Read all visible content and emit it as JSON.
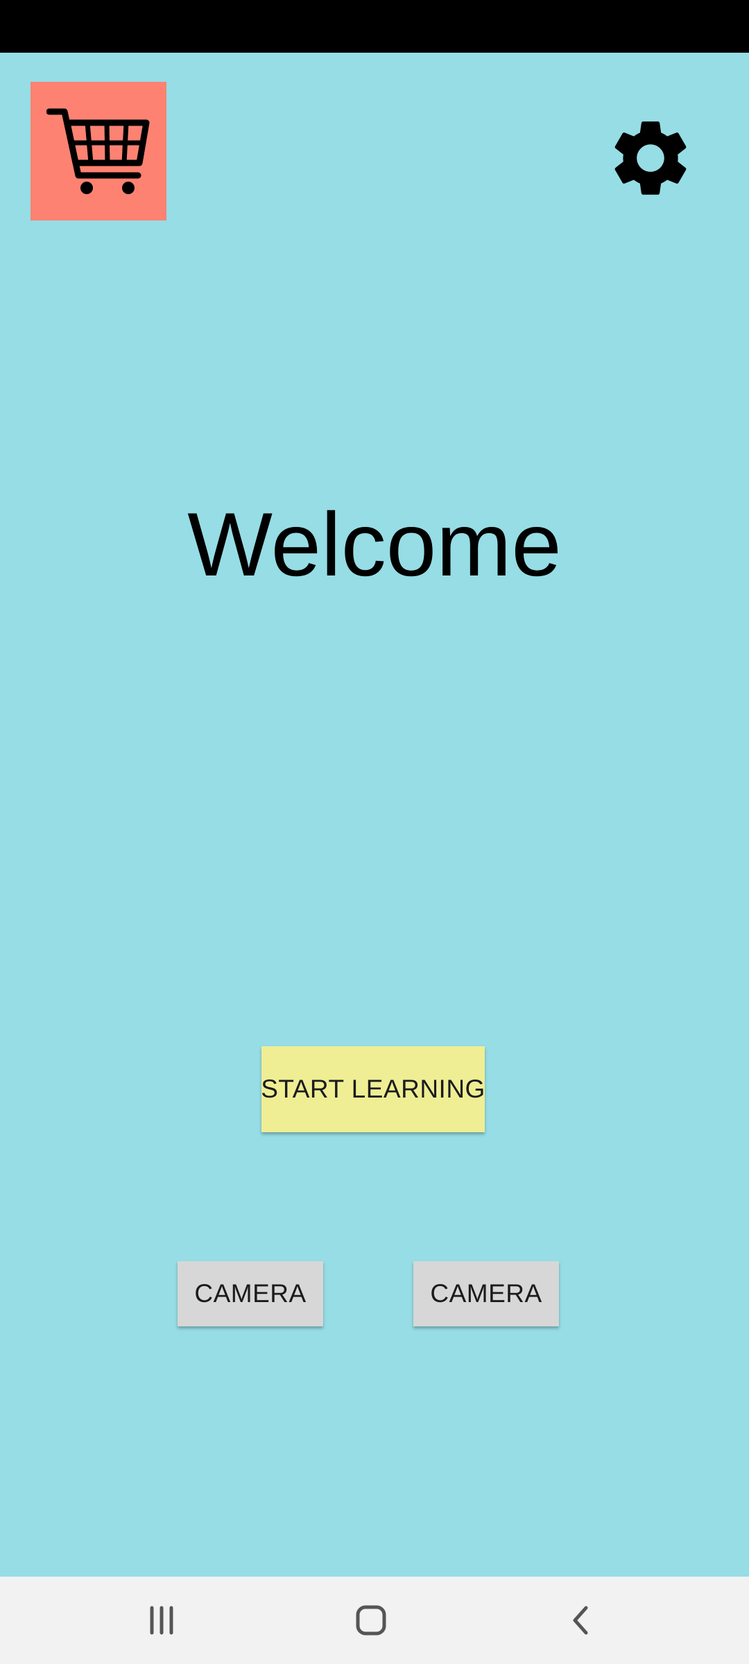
{
  "screen": {
    "background_color": "#96dde5"
  },
  "header": {
    "cart_icon": "shopping-cart-icon",
    "cart_button_color": "#fd8272",
    "settings_icon": "gear-icon"
  },
  "main": {
    "title": "Welcome"
  },
  "actions": {
    "start_learning_label": "START LEARNING",
    "start_learning_color": "#efee94",
    "camera_1_label": "CAMERA",
    "camera_2_label": "CAMERA",
    "camera_color": "#d7d7d7"
  },
  "nav_bar": {
    "recents_icon": "recents-icon",
    "home_icon": "home-icon",
    "back_icon": "back-icon"
  }
}
